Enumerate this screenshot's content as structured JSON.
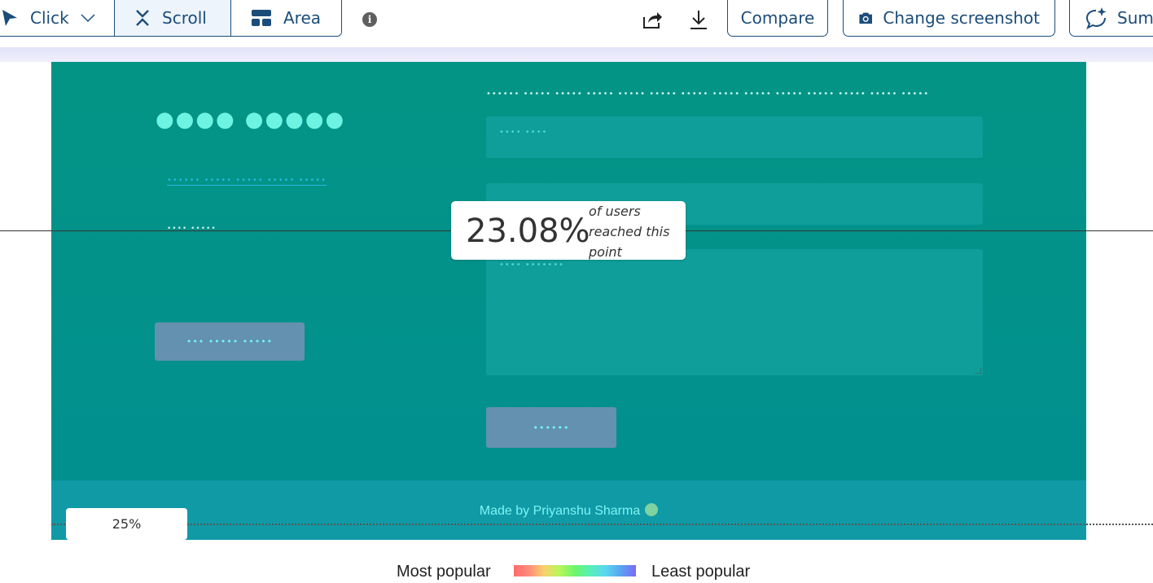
{
  "toolbar": {
    "modes": [
      {
        "label": "Click",
        "icon": "cursor-icon"
      },
      {
        "label": "Scroll",
        "icon": "scroll-icon"
      },
      {
        "label": "Area",
        "icon": "area-icon"
      }
    ],
    "compare_label": "Compare",
    "change_screenshot_label": "Change screenshot",
    "summary_label": "Sum"
  },
  "page": {
    "heading_dots": "●●●● ●●●●●",
    "link_dots": "•••••• ••••• ••••• ••••• •••••",
    "small_dots": "•••• •••••",
    "left_button_dots": "••• ••••• •••••",
    "form_label_dots": "•••••• ••••• ••••• ••••• ••••• ••••• ••••• ••••• ••••• ••••• ••••• ••••• ••••• •••••",
    "field1_dots": "•••• ••••",
    "field3_dots": "•••• •••••••",
    "send_button_dots": "••••••",
    "footer_text": "Made by Priyanshu Sharma"
  },
  "overlay": {
    "percent": "23.08%",
    "percent_text": "of users reached this point",
    "scroll_marker": "25%"
  },
  "legend": {
    "left": "Most popular",
    "right": "Least popular"
  },
  "colors": {
    "accent": "#1c4d7a",
    "teal": "#039485",
    "button": "#6491b0"
  }
}
